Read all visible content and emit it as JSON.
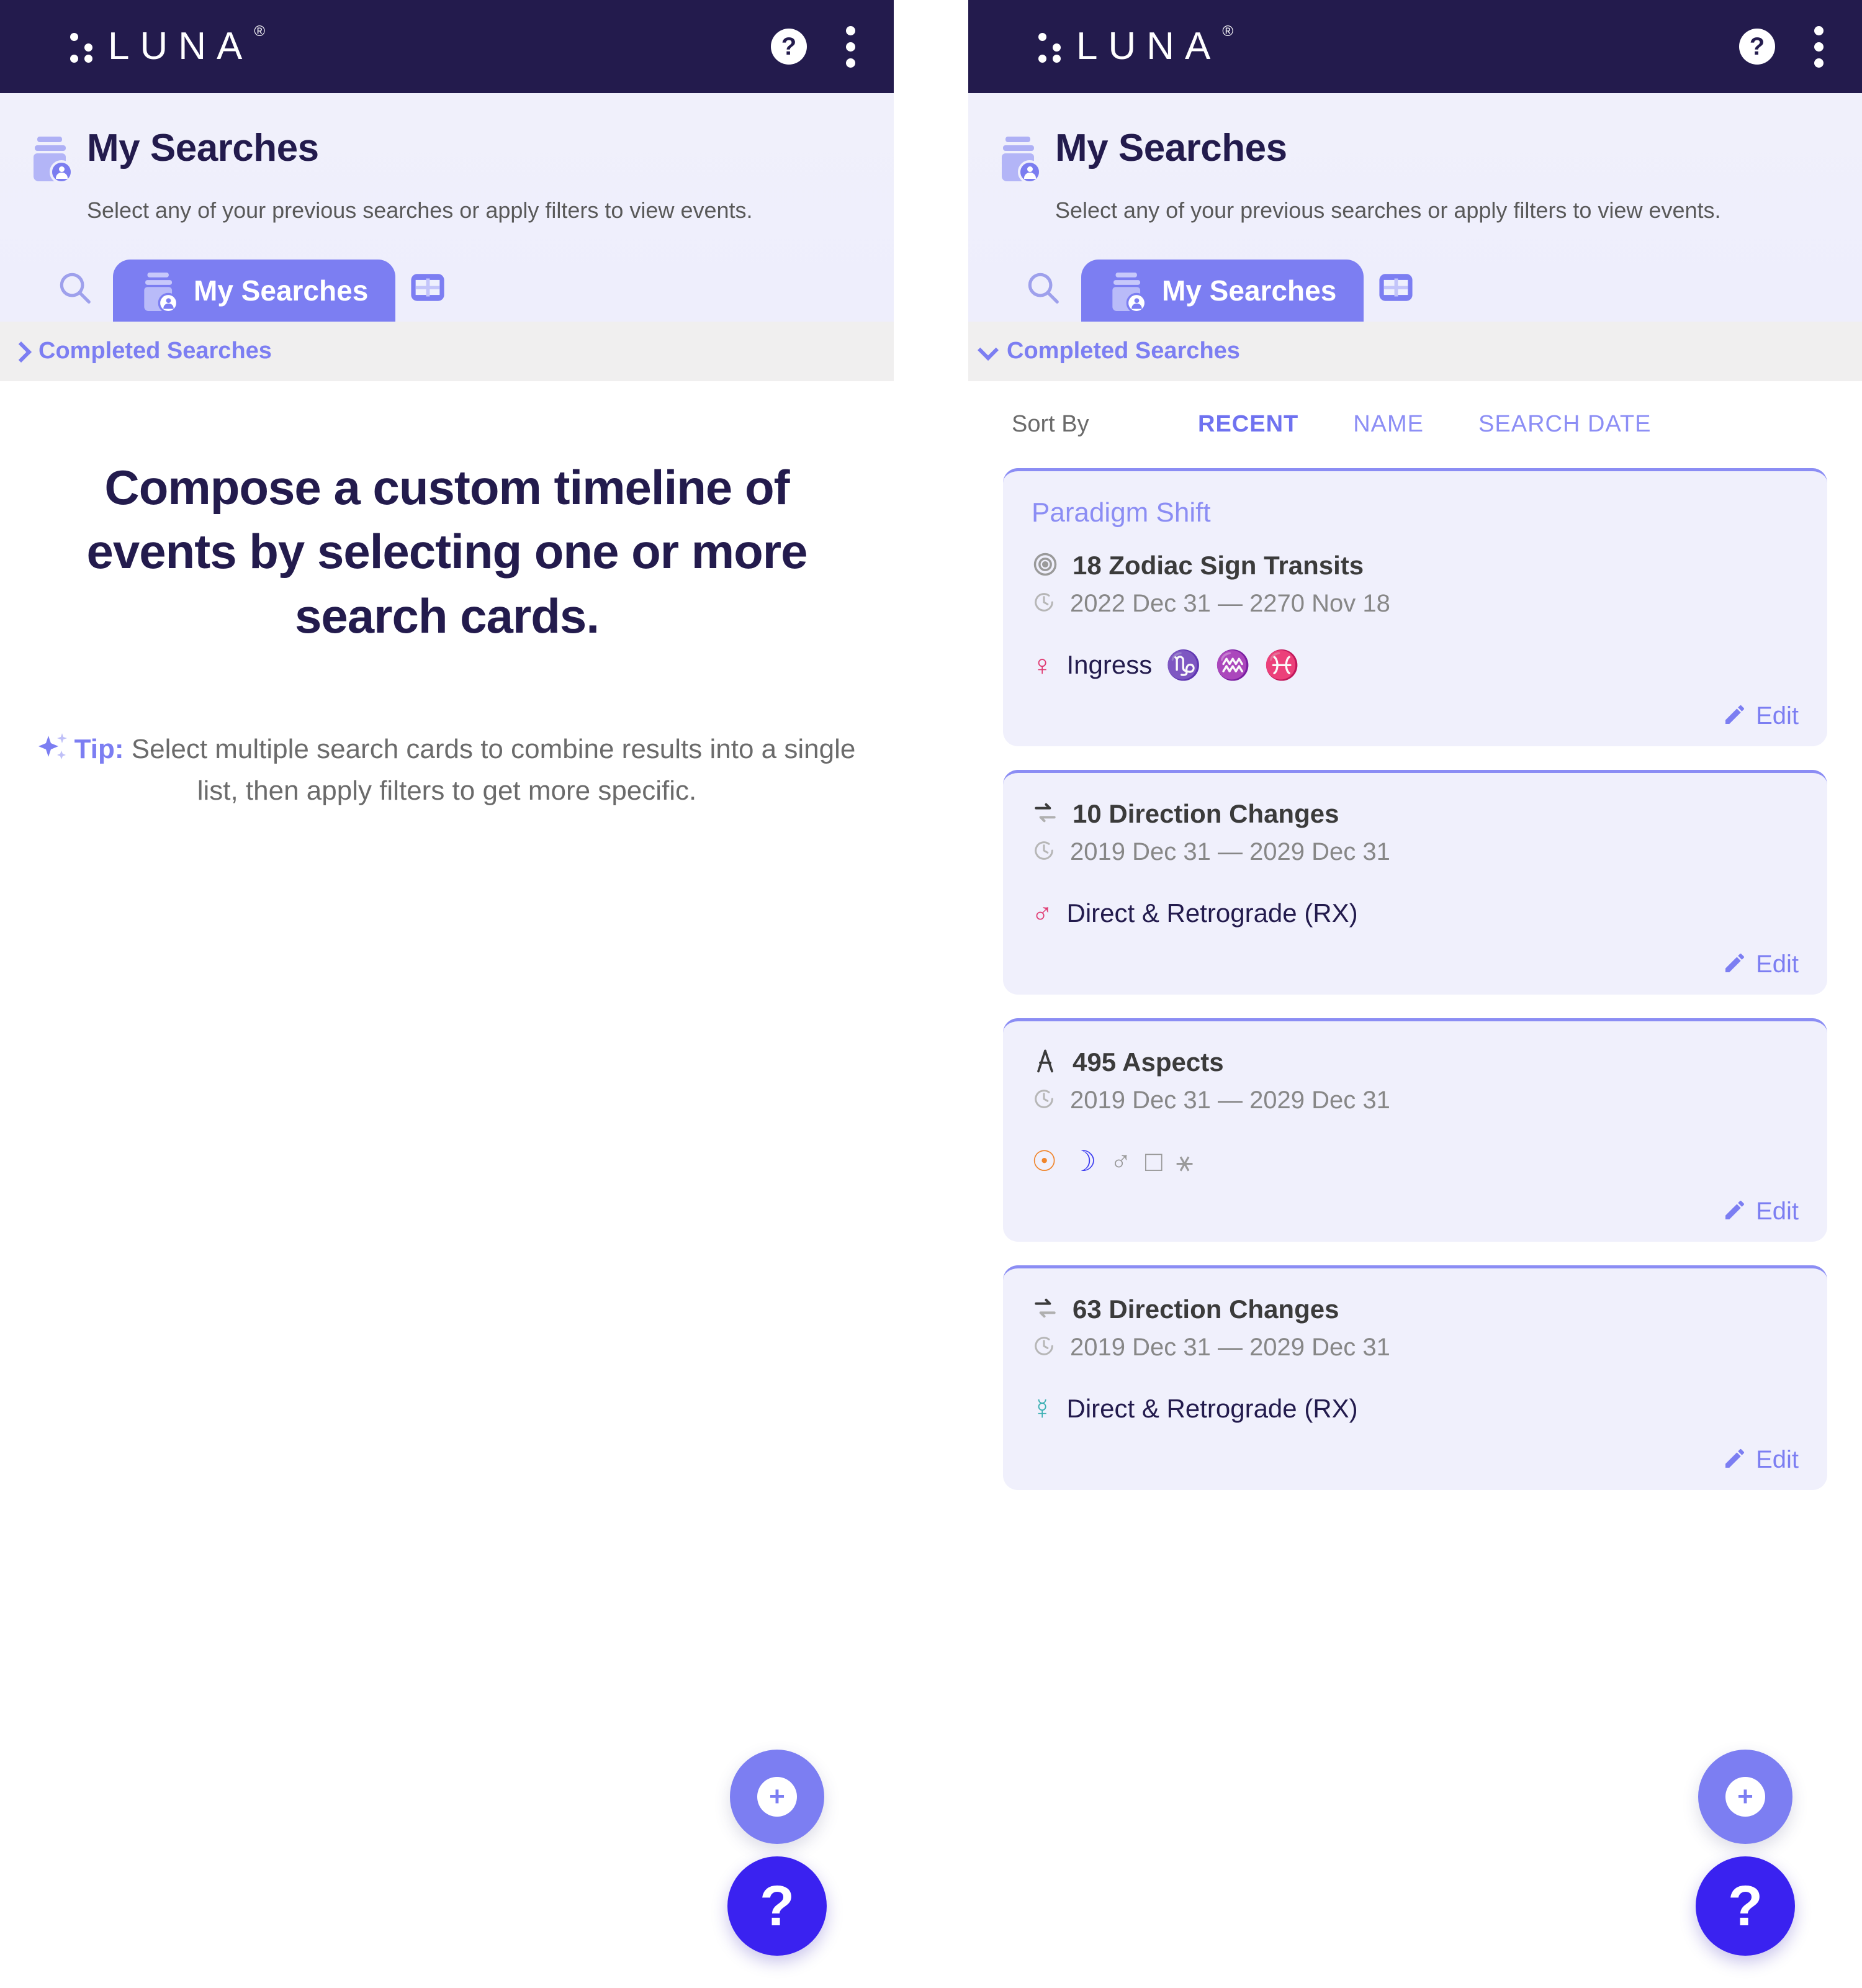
{
  "app": {
    "brand": "LUNA",
    "brand_registered": "®",
    "appbar_help_icon": "help-circle-icon",
    "appbar_menu_icon": "kebab-menu-icon",
    "colors": {
      "appbar_bg": "#231B4D",
      "accent": "#7C7EF2",
      "accent_dark": "#3A22F0",
      "card_bg": "#F0F0FC",
      "header_bg": "#F0F0FB",
      "accordion_bg": "#F0EFEF",
      "pink": "#E03B72",
      "teal": "#3AAFB2",
      "orange": "#F0852B",
      "blue": "#3B3BF0",
      "gray_glyph": "#9A9A9A"
    }
  },
  "header": {
    "icon": "search-jar-user-icon",
    "title": "My Searches",
    "subtitle": "Select any of your previous searches or apply filters to view events."
  },
  "tabs": {
    "search_icon": "search-icon",
    "grid_icon": "table-grid-icon",
    "active_tab": {
      "icon": "search-jar-user-icon",
      "label": "My Searches"
    }
  },
  "accordion": {
    "label": "Completed Searches",
    "left_state": "collapsed",
    "left_chevron": "chevron-right-icon",
    "right_state": "expanded",
    "right_chevron": "chevron-down-icon"
  },
  "left_panel": {
    "empty_heading": "Compose a custom timeline of events by selecting one or more search cards.",
    "tip_icon": "sparkle-icon",
    "tip_prefix": "Tip:",
    "tip_text": "Select multiple search cards to combine results into a single list, then apply filters to get more specific."
  },
  "right_panel": {
    "sort": {
      "label": "Sort By",
      "options": [
        {
          "label": "RECENT",
          "active": true
        },
        {
          "label": "NAME",
          "active": false
        },
        {
          "label": "SEARCH DATE",
          "active": false
        }
      ]
    },
    "edit_label": "Edit",
    "edit_icon": "pencil-icon",
    "cards": [
      {
        "name": "Paradigm Shift",
        "type_icon": "zodiac-target-icon",
        "count_label": "18 Zodiac Sign Transits",
        "clock_icon": "clock-icon",
        "date_range": "2022 Dec 31 — 2270 Nov 18",
        "body_glyph": "♀",
        "body_glyph_name": "pluto-symbol",
        "body_glyph_color": "#E03B72",
        "term_label": "Ingress",
        "sign_glyphs": [
          "♑",
          "♒",
          "♓"
        ],
        "sign_glyph_names": [
          "capricorn-symbol",
          "aquarius-symbol",
          "pisces-symbol"
        ]
      },
      {
        "name": "",
        "type_icon": "direction-change-icon",
        "count_label": "10 Direction Changes",
        "clock_icon": "clock-icon",
        "date_range": "2019 Dec 31 — 2029 Dec 31",
        "body_glyph": "♂",
        "body_glyph_name": "mars-symbol",
        "body_glyph_color": "#E03B72",
        "term_label": "Direct & Retrograde (RX)",
        "sign_glyphs": [],
        "sign_glyph_names": []
      },
      {
        "name": "",
        "type_icon": "compass-aspects-icon",
        "count_label": "495 Aspects",
        "clock_icon": "clock-icon",
        "date_range": "2019 Dec 31 — 2029 Dec 31",
        "body_glyph": "",
        "body_glyph_name": "",
        "body_glyph_color": "",
        "term_label": "",
        "sign_glyphs": [
          "☉",
          "☽",
          "♂",
          "□",
          "⚹"
        ],
        "sign_glyph_names": [
          "sun-symbol",
          "moon-symbol",
          "mars-symbol",
          "square-aspect-symbol",
          "sextile-aspect-symbol"
        ]
      },
      {
        "name": "",
        "type_icon": "direction-change-icon",
        "count_label": "63 Direction Changes",
        "clock_icon": "clock-icon",
        "date_range": "2019 Dec 31 — 2029 Dec 31",
        "body_glyph": "☿",
        "body_glyph_name": "mercury-symbol",
        "body_glyph_color": "#3AAFB2",
        "term_label": "Direct & Retrograde (RX)",
        "sign_glyphs": [],
        "sign_glyph_names": []
      }
    ]
  },
  "fabs": {
    "add_label": "+",
    "add_icon": "plus-icon",
    "help_label": "?",
    "help_icon": "question-mark-icon"
  }
}
